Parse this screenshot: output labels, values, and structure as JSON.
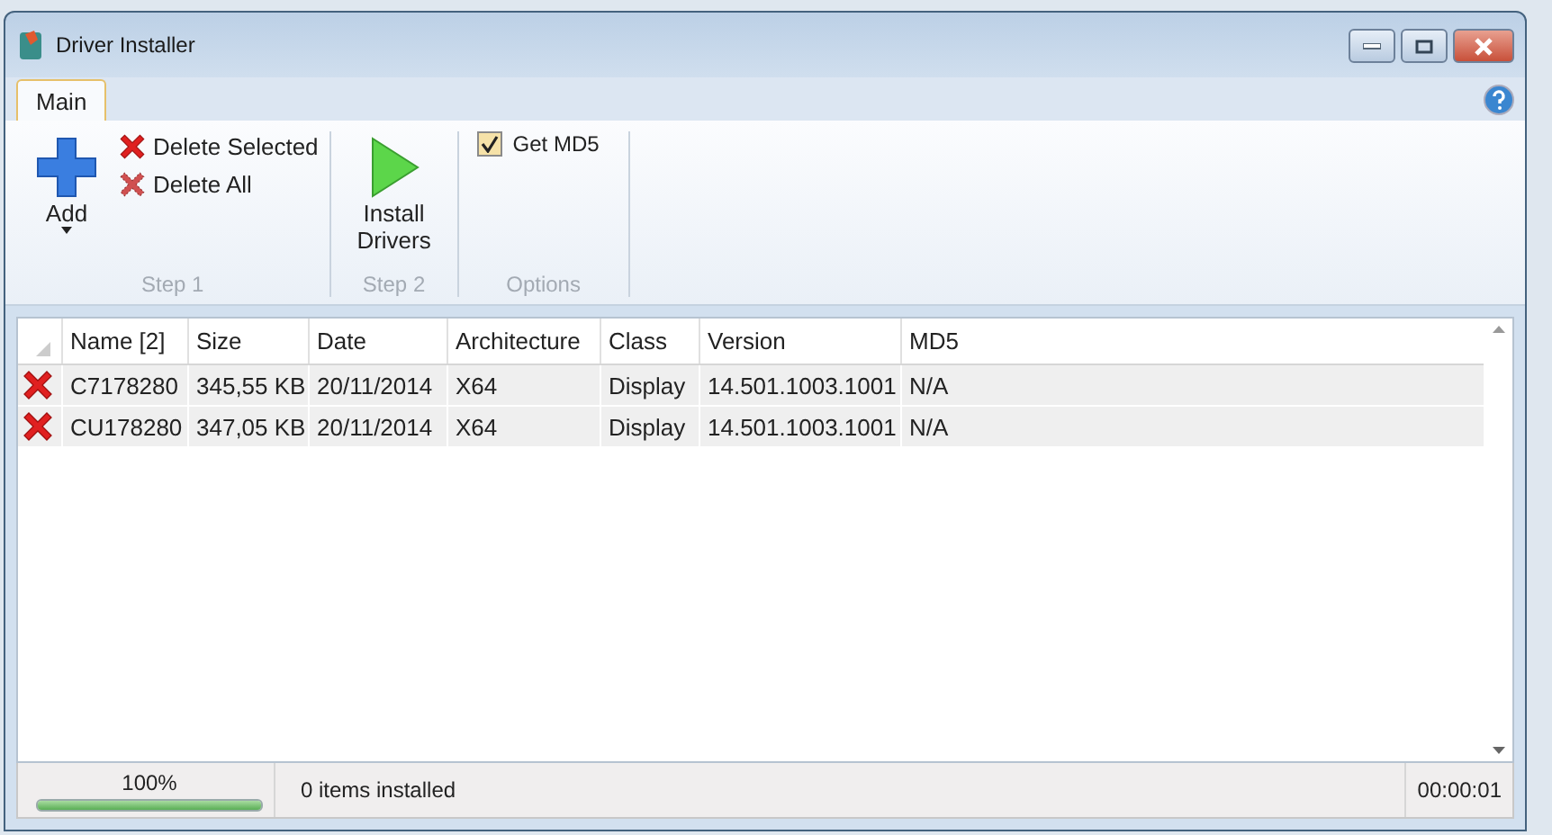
{
  "window": {
    "title": "Driver Installer"
  },
  "tabs": [
    {
      "label": "Main",
      "selected": true
    }
  ],
  "ribbon": {
    "groups": [
      {
        "label": "Step 1",
        "items": [
          {
            "kind": "large",
            "label": "Add",
            "dropdown": true
          },
          {
            "kind": "small",
            "label": "Delete Selected"
          },
          {
            "kind": "small",
            "label": "Delete All"
          }
        ]
      },
      {
        "label": "Step 2",
        "items": [
          {
            "kind": "large",
            "label": "Install Drivers",
            "dropdown": false
          }
        ]
      },
      {
        "label": "Options",
        "items": [
          {
            "kind": "check",
            "label": "Get MD5",
            "checked": true
          }
        ]
      }
    ]
  },
  "table": {
    "columns": [
      "Name [2]",
      "Size",
      "Date",
      "Architecture",
      "Class",
      "Version",
      "MD5"
    ],
    "rows": [
      [
        "C7178280",
        "345,55 KB",
        "20/11/2014",
        "X64",
        "Display",
        "14.501.1003.1001",
        "N/A"
      ],
      [
        "CU178280",
        "347,05 KB",
        "20/11/2014",
        "X64",
        "Display",
        "14.501.1003.1001",
        "N/A"
      ]
    ]
  },
  "status_bar": {
    "progress": {
      "level": 1,
      "label": "100%"
    },
    "message": "0 items installed",
    "elapsed": "00:00:01"
  }
}
